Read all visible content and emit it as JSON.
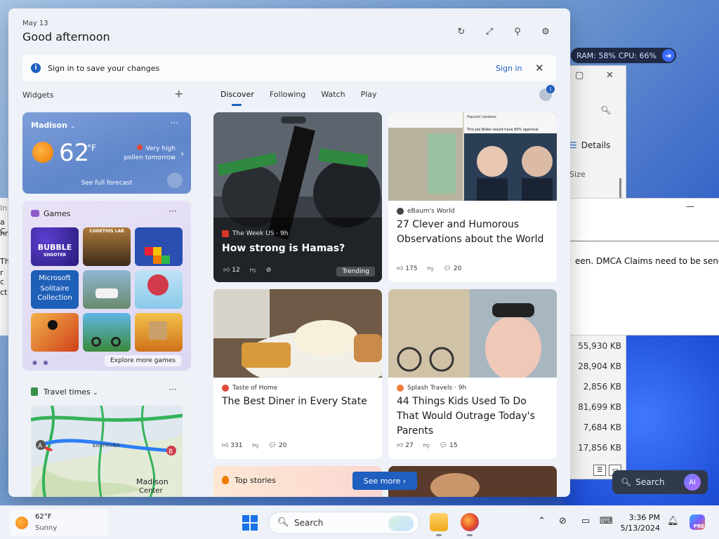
{
  "colors": {
    "accent": "#1f5fbf",
    "board_bg": "#eef1f7",
    "taskbar_bg": "#eef2f8"
  },
  "perf": {
    "ram": "RAM: 58%",
    "cpu": "CPU: 66%"
  },
  "background_windows": {
    "explorer": {
      "details": "Details",
      "size_header": "Size",
      "sizes": [
        "55,930 KB",
        "28,904 KB",
        "2,856 KB",
        "81,699 KB",
        "7,684 KB",
        "17,856 KB"
      ]
    },
    "text_window": {
      "text": "een.  DMCA Claims need to be send to th"
    },
    "left_fragments": [
      "In",
      "a C",
      "nn",
      "The",
      "r c",
      "ct"
    ]
  },
  "header": {
    "date": "May 13",
    "greeting": "Good afternoon",
    "icons": [
      "refresh-icon",
      "expand-icon",
      "pin-icon",
      "settings-icon"
    ]
  },
  "signin_bar": {
    "message": "Sign in to save your changes",
    "link": "Sign in"
  },
  "widgets": {
    "label": "Widgets",
    "weather": {
      "location": "Madison",
      "temp": "62",
      "unit": "°F",
      "alert_line1": "Very high",
      "alert_line2": "pollen tomorrow",
      "forecast_link": "See full forecast"
    },
    "games": {
      "title": "Games",
      "explore": "Explore more games",
      "tiles": [
        {
          "label": "BUBBLE",
          "sub": "SHOOTER",
          "color": "#3a2a8c"
        },
        {
          "label": "",
          "sub": "CODETHIS LAB",
          "color": "#5a3a20"
        },
        {
          "label": "",
          "sub": "",
          "color": "#2a4fb0"
        },
        {
          "label": "Microsoft",
          "sub": "Solitaire Collection",
          "color": "#1e5fb8"
        },
        {
          "label": "",
          "sub": "",
          "color": "#5a7f9a"
        },
        {
          "label": "",
          "sub": "",
          "color": "#4aa0d8"
        },
        {
          "label": "",
          "sub": "",
          "color": "#e06a1a"
        },
        {
          "label": "",
          "sub": "",
          "color": "#3fa0d0"
        },
        {
          "label": "",
          "sub": "",
          "color": "#d89a2a"
        }
      ]
    },
    "travel": {
      "title": "Travel times",
      "map_label": "Madison",
      "map_label2": "Center",
      "road_label": "EASTRIVER",
      "marker_a": "A",
      "marker_b": "B"
    }
  },
  "feed": {
    "tabs": [
      "Discover",
      "Following",
      "Watch",
      "Play"
    ],
    "profile_badge": "i",
    "hero": {
      "source": "The Week US · 9h",
      "headline": "How strong is Hamas?",
      "likes": "12",
      "trending": "Trending"
    },
    "card1": {
      "source": "eBaum's World",
      "headline": "27 Clever and Humorous Observations about the World",
      "likes": "175",
      "comments": "20",
      "img_text1": "Populist Updates",
      "img_text2": "This Joe Biden would have 80% approval"
    },
    "card2": {
      "source": "Taste of Home",
      "headline": "The Best Diner in Every State",
      "likes": "331",
      "comments": "20"
    },
    "card3": {
      "source": "Splash Travels · 9h",
      "headline": "44 Things Kids Used To Do That Would Outrage Today's Parents",
      "likes": "27",
      "comments": "15"
    },
    "top_stories": {
      "label": "Top stories",
      "see_more": "See more"
    }
  },
  "taskbar": {
    "weather": {
      "temp": "62°F",
      "condition": "Sunny"
    },
    "search": "Search",
    "floating_search": "Search",
    "copilot_badge": "PRE",
    "ai_badge": "AI",
    "time": "3:36 PM",
    "date": "5/13/2024"
  }
}
